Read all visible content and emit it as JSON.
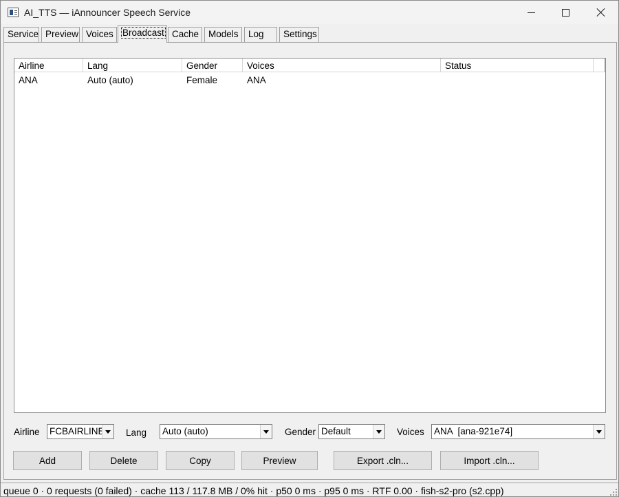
{
  "window": {
    "title": "AI_TTS — iAnnouncer Speech Service"
  },
  "tabs": [
    {
      "label": "Service"
    },
    {
      "label": "Preview"
    },
    {
      "label": "Voices"
    },
    {
      "label": "Broadcast"
    },
    {
      "label": "Cache"
    },
    {
      "label": "Models"
    },
    {
      "label": "Log"
    },
    {
      "label": "Settings"
    }
  ],
  "active_tab": "Broadcast",
  "table": {
    "columns": [
      "Airline",
      "Lang",
      "Gender",
      "Voices",
      "Status"
    ],
    "rows": [
      {
        "airline": "ANA",
        "lang": "Auto (auto)",
        "gender": "Female",
        "voices": "ANA",
        "status": ""
      }
    ]
  },
  "controls": {
    "airline_label": "Airline",
    "airline_value": "FCBAIRLINE",
    "lang_label": "Lang",
    "lang_value": "Auto (auto)",
    "gender_label": "Gender",
    "gender_value": "Default",
    "voices_label": "Voices",
    "voices_value": "ANA  [ana-921e74]"
  },
  "buttons": {
    "add": "Add",
    "delete": "Delete",
    "copy": "Copy",
    "preview": "Preview",
    "export": "Export .cln...",
    "import": "Import .cln..."
  },
  "statusbar": {
    "text": "queue 0 · 0 requests (0 failed) · cache 113 / 117.8 MB / 0% hit · p50 0 ms · p95 0 ms · RTF 0.00 · fish-s2-pro (s2.cpp)"
  }
}
